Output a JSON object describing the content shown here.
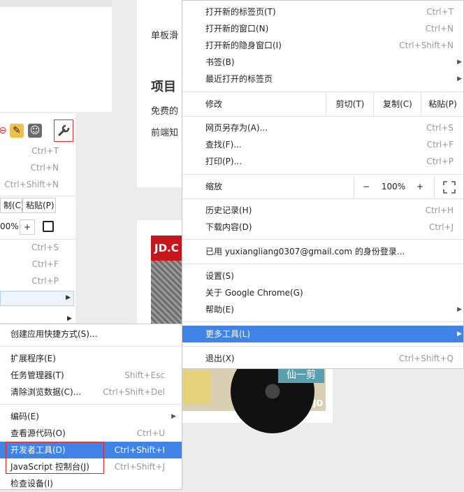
{
  "background": {
    "snippets": [
      "单板滑",
      "项目",
      "免费的",
      "前端知"
    ],
    "jd_logo": "JD.C",
    "jd_corner": "JD",
    "album_text": "仙一剪"
  },
  "mini_menu": {
    "shortcuts": [
      "Ctrl+T",
      "Ctrl+N",
      "Ctrl+Shift+N",
      "Ctrl+S",
      "Ctrl+F",
      "Ctrl+P"
    ],
    "copy_label": "制(C)",
    "paste_label": "粘贴(P)",
    "zoom_value": "00%",
    "zoom_plus": "+"
  },
  "menu": {
    "items": [
      {
        "label": "打开新的标签页(T)",
        "shortcut": "Ctrl+T"
      },
      {
        "label": "打开新的窗口(N)",
        "shortcut": "Ctrl+N"
      },
      {
        "label": "打开新的隐身窗口(I)",
        "shortcut": "Ctrl+Shift+N"
      },
      {
        "label": "书签(B)",
        "shortcut": ""
      },
      {
        "label": "最近打开的标签页",
        "shortcut": ""
      }
    ],
    "edit": {
      "label": "修改",
      "cut": "剪切(T)",
      "copy": "复制(C)",
      "paste": "粘贴(P)"
    },
    "page_items": [
      {
        "label": "网页另存为(A)...",
        "shortcut": "Ctrl+S"
      },
      {
        "label": "查找(F)...",
        "shortcut": "Ctrl+F"
      },
      {
        "label": "打印(P)...",
        "shortcut": "Ctrl+P"
      }
    ],
    "zoom": {
      "label": "缩放",
      "minus": "−",
      "value": "100%",
      "plus": "+"
    },
    "history": {
      "label": "历史记录(H)",
      "shortcut": "Ctrl+H"
    },
    "downloads": {
      "label": "下载内容(D)",
      "shortcut": "Ctrl+J"
    },
    "signed_in": "已用 yuxiangliang0307@gmail.com 的身份登录...",
    "settings": "设置(S)",
    "about": "关于 Google Chrome(G)",
    "help": "帮助(E)",
    "more_tools": "更多工具(L)",
    "exit": {
      "label": "退出(X)",
      "shortcut": "Ctrl+Shift+Q"
    }
  },
  "submenu": {
    "items": [
      {
        "label": "创建应用快捷方式(S)...",
        "shortcut": ""
      },
      {
        "label": "扩展程序(E)",
        "shortcut": ""
      },
      {
        "label": "任务管理器(T)",
        "shortcut": "Shift+Esc"
      },
      {
        "label": "清除浏览数据(C)...",
        "shortcut": "Ctrl+Shift+Del"
      },
      {
        "label": "编码(E)",
        "shortcut": ""
      },
      {
        "label": "查看源代码(O)",
        "shortcut": "Ctrl+U"
      },
      {
        "label": "开发者工具(D)",
        "shortcut": "Ctrl+Shift+I"
      },
      {
        "label": "JavaScript 控制台(J)",
        "shortcut": "Ctrl+Shift+J"
      },
      {
        "label": "检查设备(I)",
        "shortcut": ""
      }
    ]
  },
  "colors": {
    "highlight": "#3f83e6",
    "annotation_red": "#e02424",
    "jd_red": "#c8161d"
  }
}
